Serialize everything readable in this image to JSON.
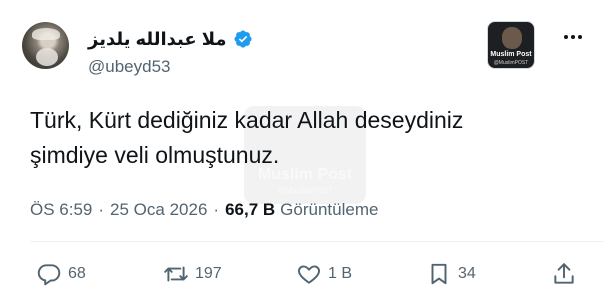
{
  "author": {
    "display_name": "ملا عبدالله یلدیز",
    "handle": "@ubeyd53",
    "verified_icon": "verified-badge-icon",
    "verified_color": "#1d9bf0"
  },
  "affiliate_badge": {
    "title": "Muslim Post",
    "subtitle": "@MuslimPOST"
  },
  "tweet": {
    "line1": "Türk, Kürt dediğiniz kadar Allah deseydiniz",
    "line2": "şimdiye veli olmuştunuz."
  },
  "watermark": {
    "title": "Muslim Post",
    "subtitle": "@MuslimPOST"
  },
  "meta": {
    "time": "ÖS 6:59",
    "separator": "·",
    "date": "25 Oca 2026",
    "views_count": "66,7 B",
    "views_label": "Görüntüleme"
  },
  "actions": {
    "reply": {
      "icon": "reply-icon",
      "count": "68"
    },
    "retweet": {
      "icon": "retweet-icon",
      "count": "197"
    },
    "like": {
      "icon": "heart-icon",
      "count": "1 B"
    },
    "bookmark": {
      "icon": "bookmark-icon",
      "count": "34"
    },
    "share": {
      "icon": "share-icon"
    }
  },
  "colors": {
    "text_primary": "#0f1419",
    "text_secondary": "#536471",
    "accent": "#1d9bf0"
  }
}
